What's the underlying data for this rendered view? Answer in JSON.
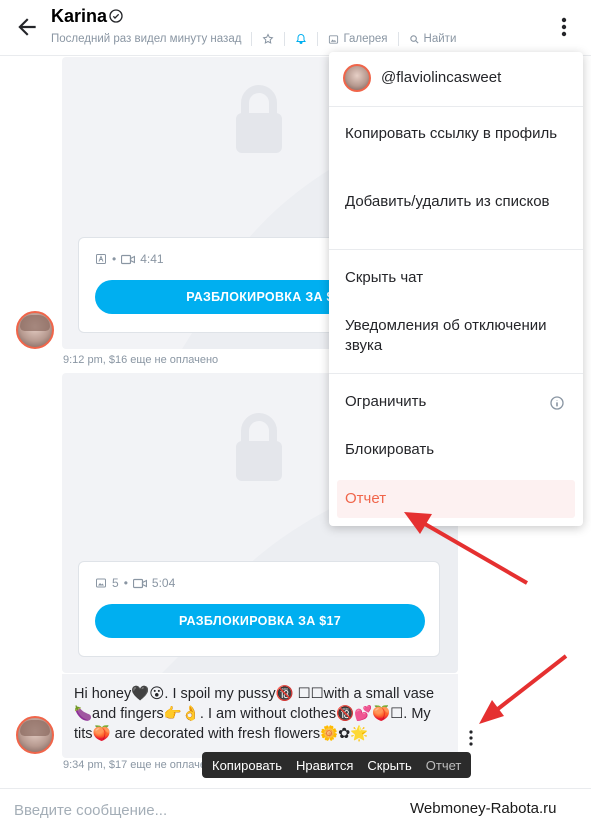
{
  "header": {
    "title": "Karina",
    "last_seen": "Последний раз видел минуту назад",
    "gallery": "Галерея",
    "search": "Найти"
  },
  "messages": [
    {
      "media_count_icon": "A",
      "duration": "4:41",
      "unlock_label": "РАЗБЛОКИРОВКА ЗА $",
      "time": "9:12 pm,",
      "price_note": "$16 еще не оплачено"
    },
    {
      "media_count": "5",
      "duration": "5:04",
      "unlock_label": "РАЗБЛОКИРОВКА ЗА $17",
      "text": "Hi honey🖤😮. I spoil my pussy🔞 ☐☐with a small vase 🍆and fingers👉👌. I am without clothes🔞💕🍑☐. My tits🍑 are decorated with fresh flowers🌼✿🌟",
      "time": "9:34 pm,",
      "price_note": "$17 еще не оплачено"
    }
  ],
  "context_toolbar": {
    "copy": "Копировать",
    "like": "Нравится",
    "hide": "Скрыть",
    "report": "Отчет"
  },
  "composer": {
    "placeholder": "Введите сообщение..."
  },
  "watermark": "Webmoney-Rabota.ru",
  "menu": {
    "username": "@flaviolincasweet",
    "copy_link": "Копировать ссылку в профиль",
    "add_remove_lists": "Добавить/удалить из списков",
    "hide_chat": "Скрыть чат",
    "mute_notifications": "Уведомления об отключении звука",
    "restrict": "Ограничить",
    "block": "Блокировать",
    "report": "Отчет"
  },
  "colors": {
    "accent": "#00aff0",
    "report": "#f0654a",
    "annotation_arrow": "#e53030"
  }
}
